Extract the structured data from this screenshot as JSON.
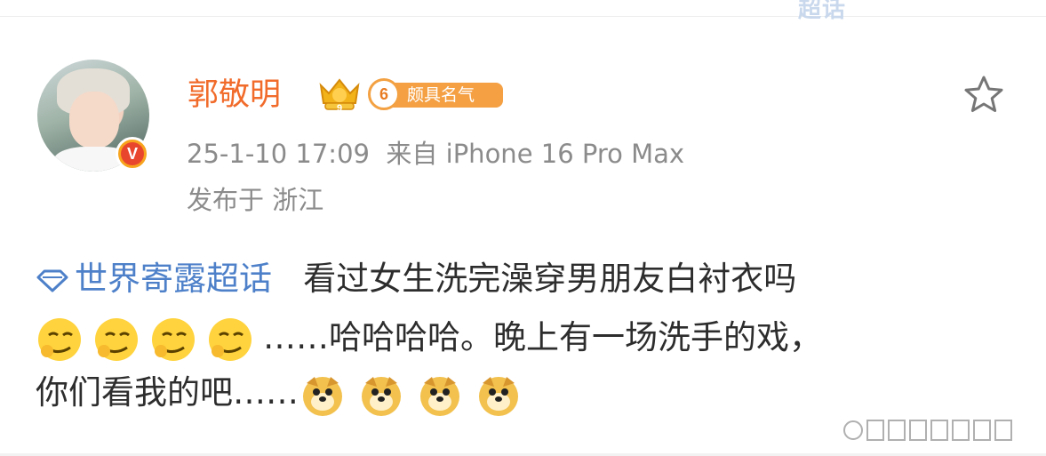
{
  "header": {
    "fragment": "超话"
  },
  "user": {
    "name": "郭敬明",
    "crown_level": "9",
    "fame_level": "6",
    "fame_label": "颇具名气",
    "verified_mark": "V"
  },
  "post_meta": {
    "timestamp": "25-1-10 17:09",
    "source": "来自 iPhone 16 Pro Max",
    "location": "发布于 浙江"
  },
  "post": {
    "topic": "世界寄露超话",
    "line1_text": "看过女生洗完澡穿男朋友白衬衣吗",
    "line2_text": "……哈哈哈哈。晚上有一场洗手的戏，",
    "line3_text": "你们看我的吧……",
    "line2_emojis": [
      "smirk-emoji",
      "smirk-emoji",
      "smirk-emoji",
      "smirk-emoji"
    ],
    "line3_emojis": [
      "doge-emoji",
      "doge-emoji",
      "doge-emoji",
      "doge-emoji"
    ]
  },
  "colors": {
    "username": "#f16b2b",
    "topic": "#4d80c9",
    "meta": "#8b8b8b",
    "body": "#2d2d2d",
    "fame_badge": "#f4a043"
  }
}
